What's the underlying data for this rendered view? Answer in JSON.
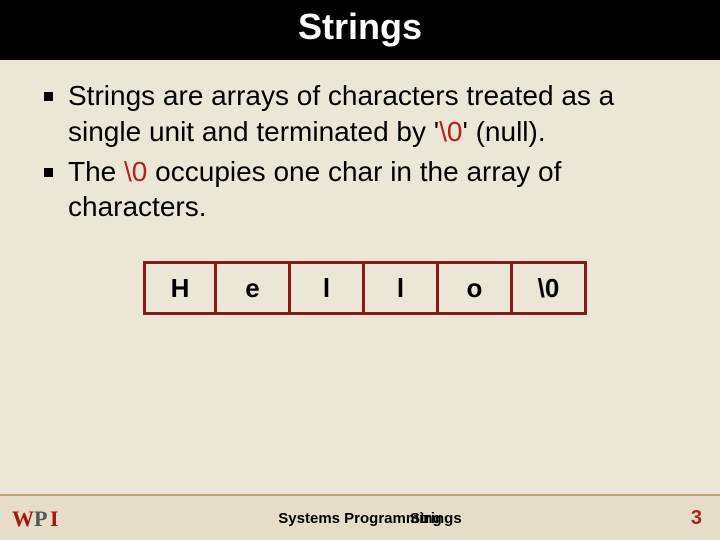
{
  "title": "Strings",
  "bullets": [
    {
      "pre": "Strings are arrays of characters treated as a single unit and terminated by '",
      "hl": "\\0",
      "post": "' (null)."
    },
    {
      "pre": "The ",
      "hl": "\\0",
      "post": " occupies one char in the array of characters."
    }
  ],
  "array_cells": [
    "H",
    "e",
    "l",
    "l",
    "o",
    "\\0"
  ],
  "footer": {
    "logo_text": "WPI",
    "center": "Systems Programming",
    "topic": "Strings",
    "page": "3"
  }
}
